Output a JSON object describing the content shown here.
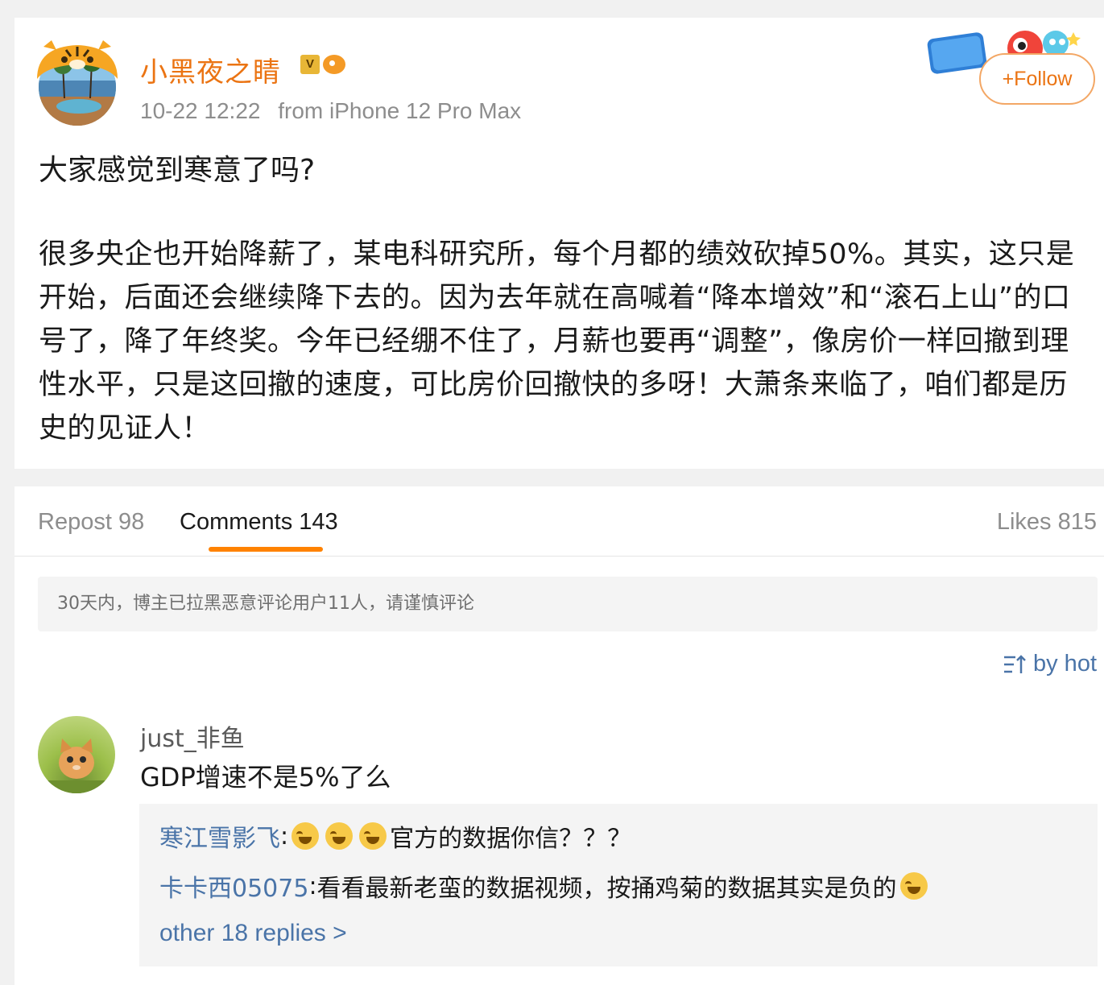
{
  "post": {
    "username": "小黑夜之睛",
    "badge_text": "V",
    "time": "10-22 12:22",
    "source": "from iPhone 12 Pro Max",
    "follow_label": "+Follow",
    "title": "大家感觉到寒意了吗?",
    "body": "很多央企也开始降薪了，某电科研究所，每个月都的绩效砍掉50%。其实，这只是开始，后面还会继续降下去的。因为去年就在高喊着“降本增效”和“滚石上山”的口号了，降了年终奖。今年已经绷不住了，月薪也要再“调整”，像房价一样回撤到理性水平，只是这回撤的速度，可比房价回撤快的多呀！大萧条来临了，咱们都是历史的见证人！"
  },
  "tabs": {
    "repost": "Repost 98",
    "comments": "Comments 143",
    "likes": "Likes 815"
  },
  "notice": "30天内，博主已拉黑恶意评论用户11人，请谨慎评论",
  "sort_label": "by hot",
  "comment": {
    "username": "just_非鱼",
    "text": "GDP增速不是5%了么",
    "replies": [
      {
        "name": "寒江雪影飞",
        "text": "官方的数据你信？？？",
        "emoji_count": 3,
        "emoji_position": "before"
      },
      {
        "name": "卡卡西05075",
        "text": "看看最新老蛮的数据视频，按捅鸡菊的数据其实是负的",
        "emoji_count": 1,
        "emoji_position": "after"
      }
    ],
    "more_replies": "other 18 replies >"
  },
  "colors": {
    "accent_orange": "#eb7413",
    "link_blue": "#4a74a8",
    "tab_underline": "#ff8200"
  },
  "icons": {
    "sort": "sort-icon",
    "badge": "vip-badge-icon",
    "decoration": "national-day-badge-icon"
  }
}
